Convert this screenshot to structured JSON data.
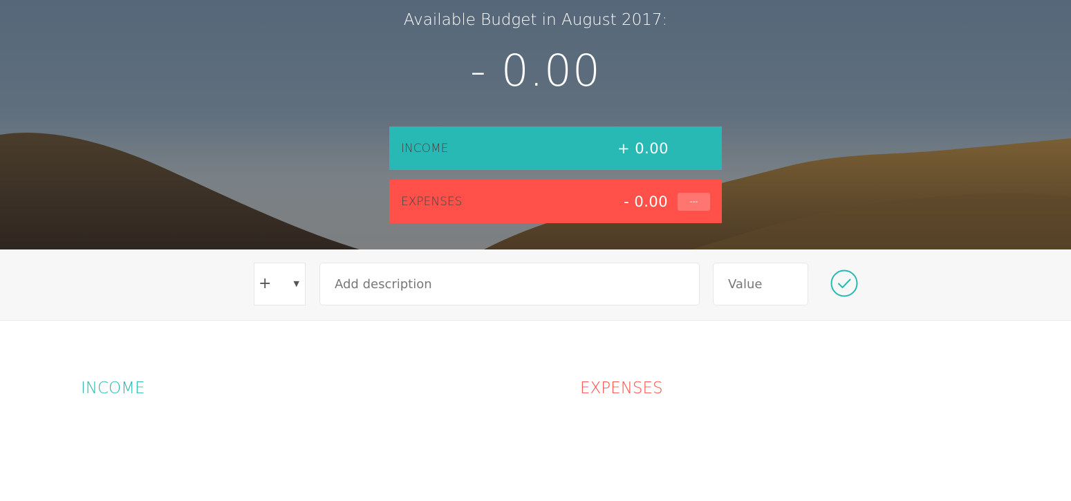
{
  "budget": {
    "title": "Available Budget in August 2017:",
    "value": "- 0.00"
  },
  "income_summary": {
    "label": "INCOME",
    "value": "+ 0.00"
  },
  "expenses_summary": {
    "label": "EXPENSES",
    "value": "- 0.00",
    "percentage": "---"
  },
  "add_form": {
    "type_selected": "+",
    "description_placeholder": "Add description",
    "value_placeholder": "Value"
  },
  "lists": {
    "income_title": "INCOME",
    "expenses_title": "EXPENSES"
  },
  "colors": {
    "income": "#28b9b5",
    "expenses": "#ff5049"
  },
  "icons": {
    "add_button": "check-circle-icon",
    "type_dropdown": "dropdown-arrow-icon"
  }
}
